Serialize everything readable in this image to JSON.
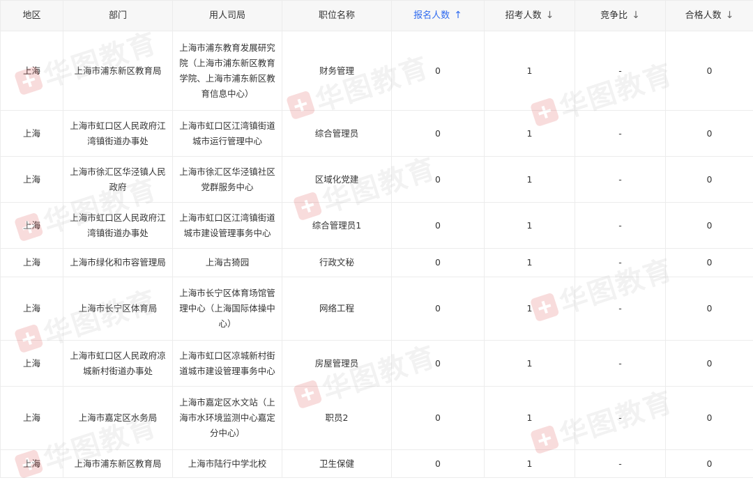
{
  "watermark": {
    "text": "华图教育",
    "logo_color": "#d62b2b"
  },
  "table": {
    "headers": {
      "region": "地区",
      "department": "部门",
      "employer": "用人司局",
      "position": "职位名称",
      "applicants": "报名人数",
      "recruits": "招考人数",
      "ratio": "竞争比",
      "qualified": "合格人数"
    },
    "sort": {
      "applicants_arrow": "↑",
      "recruits_arrow": "↓",
      "ratio_arrow": "↓",
      "qualified_arrow": "↓",
      "active_color": "#2f6bf0"
    },
    "rows": [
      {
        "region": "上海",
        "department": "上海市浦东新区教育局",
        "employer": "上海市浦东教育发展研究院（上海市浦东新区教育学院、上海市浦东新区教育信息中心）",
        "position": "财务管理",
        "applicants": "0",
        "recruits": "1",
        "ratio": "-",
        "qualified": "0"
      },
      {
        "region": "上海",
        "department": "上海市虹口区人民政府江湾镇街道办事处",
        "employer": "上海市虹口区江湾镇街道城市运行管理中心",
        "position": "综合管理员",
        "applicants": "0",
        "recruits": "1",
        "ratio": "-",
        "qualified": "0"
      },
      {
        "region": "上海",
        "department": "上海市徐汇区华泾镇人民政府",
        "employer": "上海市徐汇区华泾镇社区党群服务中心",
        "position": "区域化党建",
        "applicants": "0",
        "recruits": "1",
        "ratio": "-",
        "qualified": "0"
      },
      {
        "region": "上海",
        "department": "上海市虹口区人民政府江湾镇街道办事处",
        "employer": "上海市虹口区江湾镇街道城市建设管理事务中心",
        "position": "综合管理员1",
        "applicants": "0",
        "recruits": "1",
        "ratio": "-",
        "qualified": "0"
      },
      {
        "region": "上海",
        "department": "上海市绿化和市容管理局",
        "employer": "上海古猗园",
        "position": "行政文秘",
        "applicants": "0",
        "recruits": "1",
        "ratio": "-",
        "qualified": "0"
      },
      {
        "region": "上海",
        "department": "上海市长宁区体育局",
        "employer": "上海市长宁区体育场馆管理中心（上海国际体操中心）",
        "position": "网络工程",
        "applicants": "0",
        "recruits": "1",
        "ratio": "-",
        "qualified": "0"
      },
      {
        "region": "上海",
        "department": "上海市虹口区人民政府凉城新村街道办事处",
        "employer": "上海市虹口区凉城新村街道城市建设管理事务中心",
        "position": "房屋管理员",
        "applicants": "0",
        "recruits": "1",
        "ratio": "-",
        "qualified": "0"
      },
      {
        "region": "上海",
        "department": "上海市嘉定区水务局",
        "employer": "上海市嘉定区水文站（上海市水环境监测中心嘉定分中心）",
        "position": "职员2",
        "applicants": "0",
        "recruits": "1",
        "ratio": "-",
        "qualified": "0"
      },
      {
        "region": "上海",
        "department": "上海市浦东新区教育局",
        "employer": "上海市陆行中学北校",
        "position": "卫生保健",
        "applicants": "0",
        "recruits": "1",
        "ratio": "-",
        "qualified": "0"
      }
    ]
  }
}
